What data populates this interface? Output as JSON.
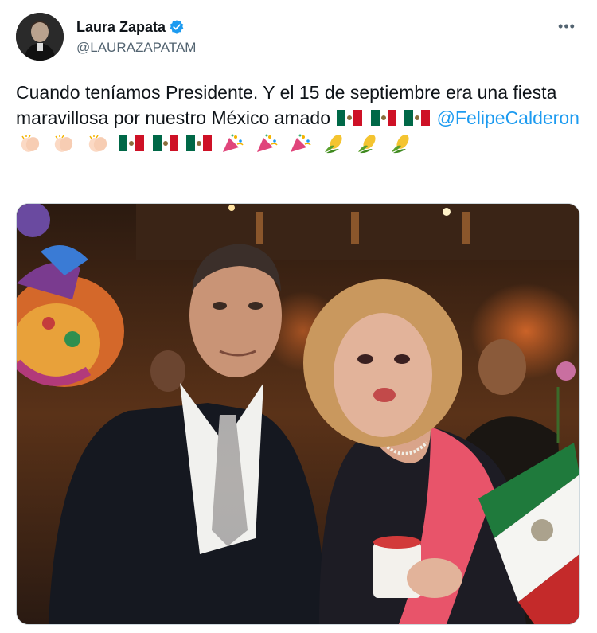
{
  "tweet": {
    "author": {
      "display_name": "Laura Zapata",
      "handle": "@LAURAZAPATAM",
      "verified": true
    },
    "more_menu": "•••",
    "text_part1": "Cuando teníamos Presidente. Y el 15 de septiembre era una fiesta maravillosa por nuestro México amado",
    "mention": "@FelipeCalderon",
    "emoji_sequence_1": [
      "mexico-flag",
      "mexico-flag",
      "mexico-flag"
    ],
    "emoji_sequence_2": [
      "clapping-hands",
      "clapping-hands",
      "clapping-hands",
      "mexico-flag",
      "mexico-flag",
      "mexico-flag",
      "party-popper",
      "party-popper",
      "party-popper",
      "corn",
      "corn",
      "corn"
    ],
    "media": {
      "type": "photo",
      "description_icon": "photo"
    }
  },
  "colors": {
    "text": "#0f1419",
    "secondary": "#536471",
    "link": "#1d9bf0",
    "verified": "#1d9bf0",
    "border": "#cfd9de"
  }
}
